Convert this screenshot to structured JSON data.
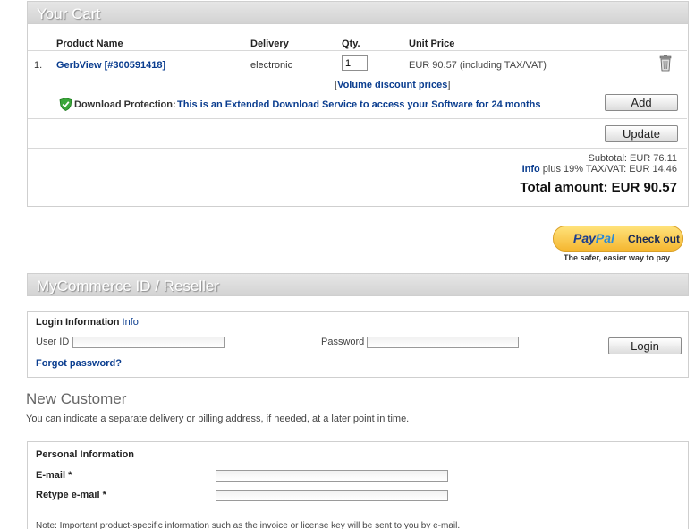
{
  "cart": {
    "title": "Your Cart",
    "columns": {
      "product": "Product Name",
      "delivery": "Delivery",
      "qty": "Qty.",
      "unit_price": "Unit Price"
    },
    "items": [
      {
        "index": "1.",
        "name": "GerbView [#300591418]",
        "delivery": "electronic",
        "qty": "1",
        "price": "EUR 90.57 (including TAX/VAT)"
      }
    ],
    "discount": {
      "open": "[",
      "link": "Volume discount prices",
      "close": "]"
    },
    "download_protection": {
      "label": "Download Protection:",
      "text": "This is an Extended Download Service to access your Software for 24 months",
      "add_label": "Add"
    },
    "update_label": "Update",
    "subtotal": "Subtotal: EUR 76.11",
    "tax_link": "Info",
    "tax_text": "plus 19% TAX/VAT: EUR 14.46",
    "total": "Total amount: EUR 90.57"
  },
  "paypal": {
    "logo_pay": "Pay",
    "logo_pal": "Pal",
    "check_out": "Check out",
    "tagline": "The safer, easier way to pay",
    "colors": {
      "pill_top": "#ffe27a",
      "pill_bottom": "#f5b731",
      "logo_dark": "#1a3d8f",
      "logo_light": "#2b8ad6"
    }
  },
  "reseller": {
    "title": "MyCommerce ID / Reseller"
  },
  "login": {
    "heading": "Login Information",
    "info_link": "Info",
    "user_label": "User ID",
    "user_value": "",
    "password_label": "Password",
    "password_value": "",
    "login_label": "Login",
    "forgot": "Forgot password?"
  },
  "new_customer": {
    "title": "New Customer",
    "note": "You can indicate a separate delivery or billing address, if needed, at a later point in time.",
    "personal_heading": "Personal Information",
    "email_label": "E-mail *",
    "email_value": "",
    "retype_label": "Retype e-mail *",
    "retype_value": "",
    "footnote": "Note: Important product-specific information such as the invoice or license key will be sent to you by e-mail."
  },
  "colors": {
    "link": "#0a3d8f",
    "bar_top": "#e6e6e6",
    "bar_bottom": "#d3d3d3",
    "shield_green": "#3aa63a"
  }
}
